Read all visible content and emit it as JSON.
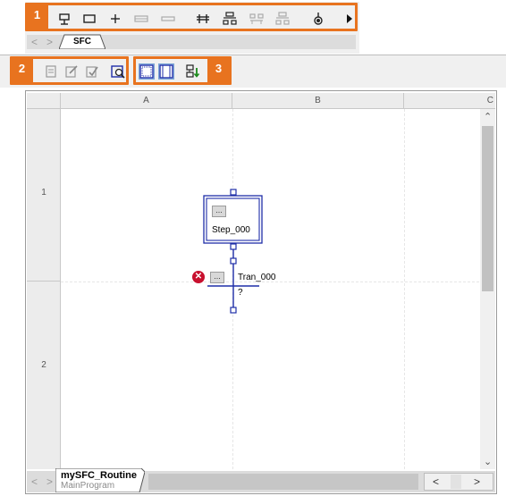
{
  "callouts": {
    "one": "1",
    "two": "2",
    "three": "3"
  },
  "tabs": {
    "top_tab": "SFC"
  },
  "columns": [
    "A",
    "B",
    "C"
  ],
  "rows": [
    "1",
    "2"
  ],
  "step": {
    "name": "Step_000",
    "action_button": "..."
  },
  "transition": {
    "name": "Tran_000",
    "button": "...",
    "condition": "?"
  },
  "bottom_tab": {
    "routine": "mySFC_Routine",
    "program": "MainProgram"
  },
  "icons": {
    "toolbar1": [
      "new-step-icon",
      "new-transition-icon",
      "add-step-transition-icon",
      "new-branch-icon",
      "new-selection-branch-icon",
      "simultaneous-branch-icon",
      "parallel-branch-icon",
      "selection-branch-icon",
      "loop-branch-icon",
      "stop-icon",
      "overflow-arrow-icon"
    ],
    "toolbar2": [
      "edit-properties-icon",
      "edit-action-icon",
      "verify-icon",
      "zoom-icon"
    ],
    "toolbar3": [
      "grid-view-icon",
      "sheet-view-icon",
      "insert-element-icon"
    ]
  },
  "colors": {
    "accent_orange": "#e8731f",
    "sfc_blue": "#1f2ea8",
    "error_red": "#c8102e"
  }
}
